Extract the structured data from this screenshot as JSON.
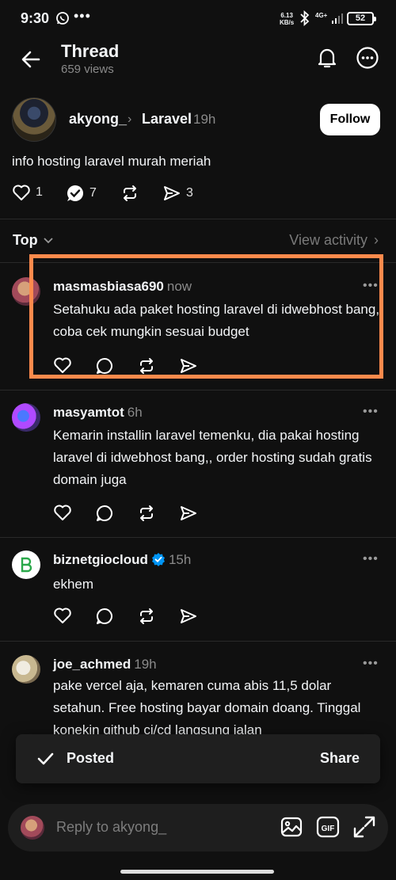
{
  "status_bar": {
    "time": "9:30",
    "net_speed_value": "6.13",
    "net_speed_unit": "KB/s",
    "network": "4G+",
    "battery": "52"
  },
  "header": {
    "title": "Thread",
    "views": "659 views"
  },
  "post": {
    "username": "akyong_",
    "community": "Laravel",
    "time": "19h",
    "follow_label": "Follow",
    "text": "info hosting laravel murah meriah",
    "likes": "1",
    "comments": "7",
    "shares": "3"
  },
  "sort": {
    "label": "Top",
    "view_activity": "View activity"
  },
  "replies": [
    {
      "username": "masmasbiasa690",
      "time": "now",
      "text": "Setahuku ada paket hosting laravel di idwebhost bang, coba cek mungkin sesuai budget"
    },
    {
      "username": "masyamtot",
      "time": "6h",
      "text": "Kemarin installin laravel temenku, dia pakai hosting laravel di idwebhost bang,, order hosting sudah gratis domain juga"
    },
    {
      "username": "biznetgiocloud",
      "time": "15h",
      "text": "ekhem"
    },
    {
      "username": "joe_achmed",
      "time": "19h",
      "text": "pake vercel aja, kemaren cuma abis 11,5 dolar setahun. Free hosting bayar domain doang. Tinggal konekin github ci/cd langsung jalan"
    }
  ],
  "toast": {
    "posted": "Posted",
    "share": "Share"
  },
  "reply_bar": {
    "placeholder": "Reply to akyong_"
  },
  "colors": {
    "background": "#101010",
    "highlight": "#ff8a4c",
    "verified": "#0095f6"
  }
}
